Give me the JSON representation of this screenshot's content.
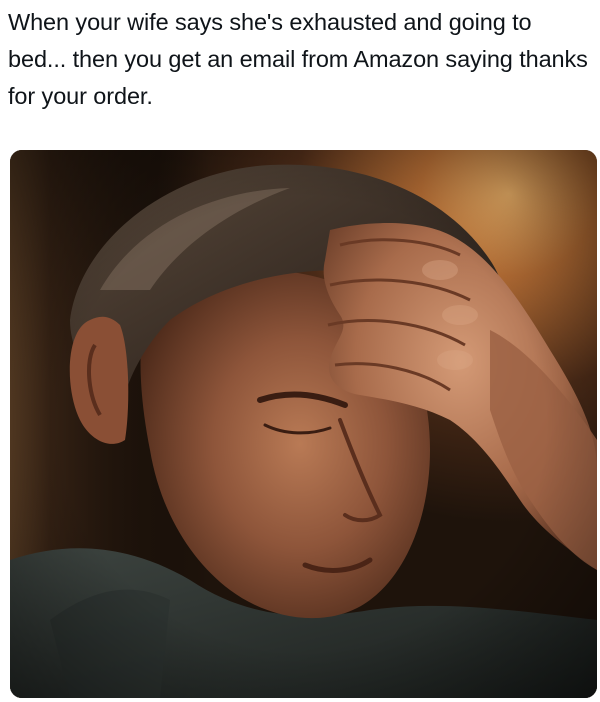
{
  "post": {
    "caption": "When your wife says she's exhausted and going to bed... then you get an email from Amazon saying thanks for your order."
  },
  "photo": {
    "subject": "man-with-hand-on-forehead"
  }
}
